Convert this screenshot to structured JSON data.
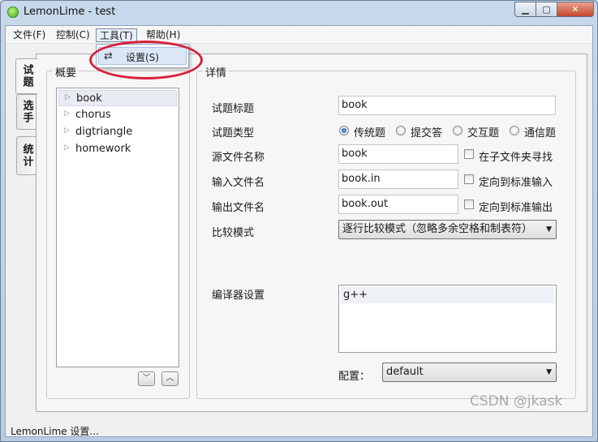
{
  "window": {
    "title": "LemonLime - test",
    "controls": {
      "minimize": "▁",
      "maximize": "▢",
      "close": "✕"
    }
  },
  "menubar": {
    "items": [
      {
        "label": "文件(F)"
      },
      {
        "label": "控制(C)"
      },
      {
        "label": "工具(T)"
      },
      {
        "label": "帮助(H)"
      }
    ]
  },
  "tools_menu": {
    "items": [
      {
        "icon": "settings-sliders-icon",
        "icon_glyph": "⇄",
        "label": "设置(S)"
      }
    ]
  },
  "side_tabs": [
    {
      "label": "试题",
      "active": true
    },
    {
      "label": "选手",
      "active": false
    },
    {
      "label": "统计",
      "active": false
    }
  ],
  "overview": {
    "title": "概要",
    "tree": [
      {
        "label": "book",
        "selected": true
      },
      {
        "label": "chorus",
        "selected": false
      },
      {
        "label": "digtriangle",
        "selected": false
      },
      {
        "label": "homework",
        "selected": false
      }
    ],
    "move_down": "﹀",
    "move_up": "︿"
  },
  "details": {
    "title": "详情",
    "problem_title_label": "试题标题",
    "problem_title_value": "book",
    "problem_type_label": "试题类型",
    "problem_types": [
      {
        "label": "传统题",
        "checked": true
      },
      {
        "label": "提交答",
        "checked": false
      },
      {
        "label": "交互题",
        "checked": false
      },
      {
        "label": "通信题",
        "checked": false
      }
    ],
    "source_name_label": "源文件名称",
    "source_name_value": "book",
    "source_subfolder_label": "在子文件夹寻找",
    "input_name_label": "输入文件名",
    "input_name_value": "book.in",
    "input_stdin_label": "定向到标准输入",
    "output_name_label": "输出文件名",
    "output_name_value": "book.out",
    "output_stdout_label": "定向到标准输出",
    "compare_mode_label": "比较模式",
    "compare_mode_value": "逐行比较模式（忽略多余空格和制表符）",
    "compiler_label": "编译器设置",
    "compilers": [
      "g++"
    ],
    "config_label": "配置：",
    "config_value": "default"
  },
  "status": {
    "text": "LemonLime 设置..."
  },
  "watermark": "CSDN @jkask",
  "colors": {
    "highlight_ring": "#d9203a",
    "radio_selected": "#1d5fa8"
  }
}
